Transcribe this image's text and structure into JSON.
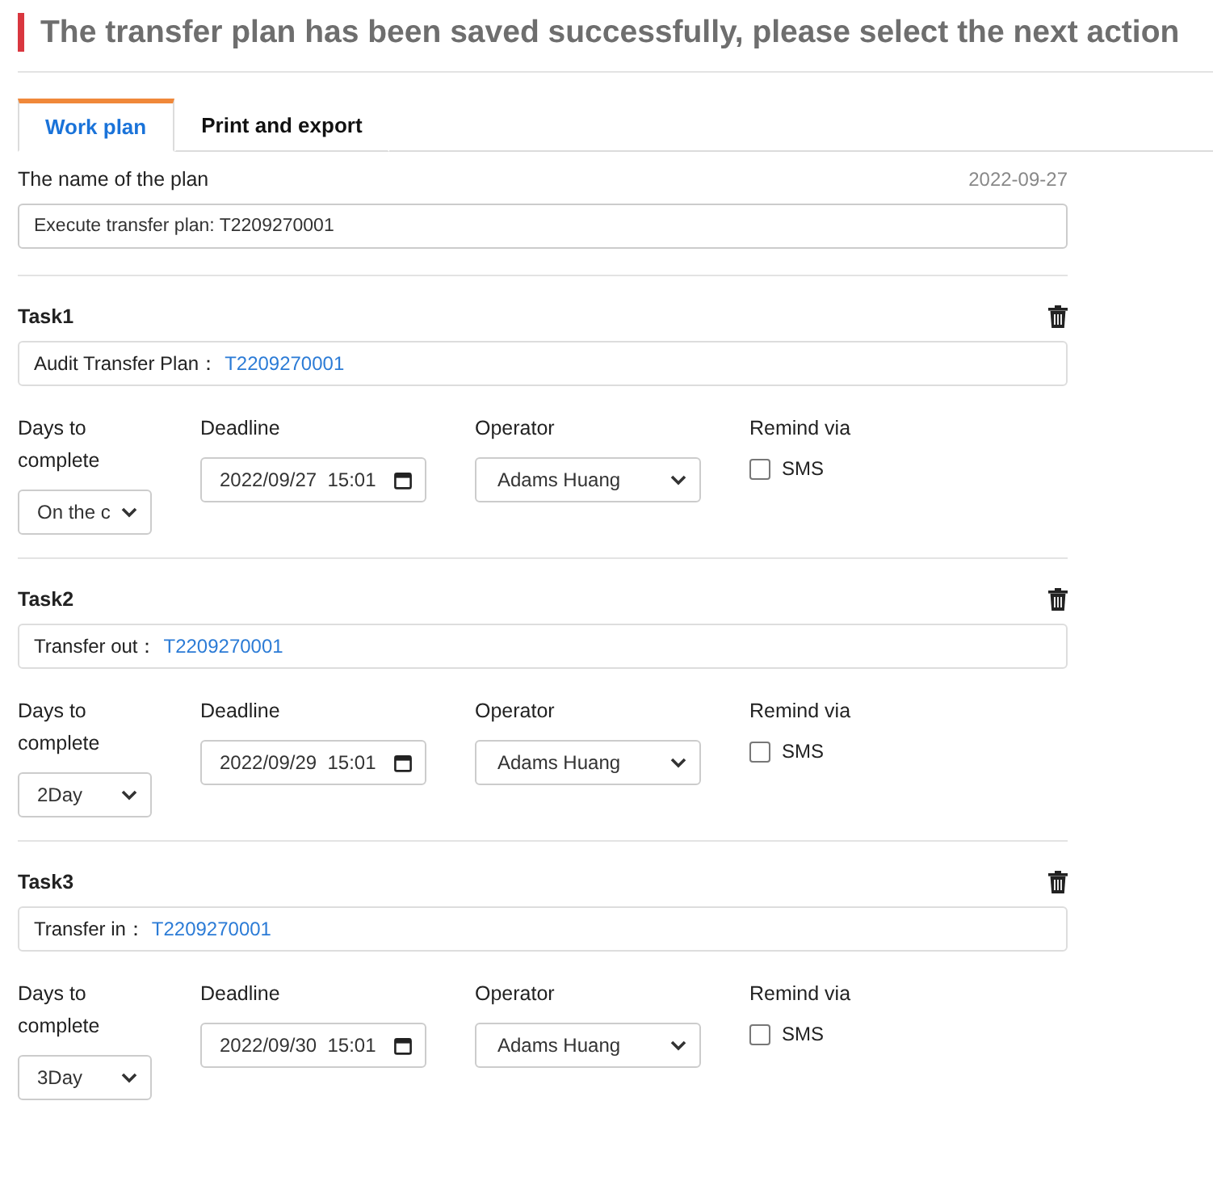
{
  "title": "The transfer plan has been saved successfully, please select the next action",
  "tabs": [
    {
      "label": "Work plan",
      "selected": true
    },
    {
      "label": "Print and export",
      "selected": false
    }
  ],
  "plan": {
    "label": "The name of the plan",
    "date": "2022-09-27",
    "value": "Execute transfer plan: T2209270001"
  },
  "tasks": [
    {
      "title": "Task1",
      "action": "Audit Transfer Plan：",
      "link": "T2209270001",
      "days_label": "Days to complete",
      "days": "On the c",
      "deadline_label": "Deadline",
      "deadline": "2022/09/27  15:01",
      "operator_label": "Operator",
      "operator": "Adams Huang",
      "remind_label": "Remind via",
      "sms": {
        "label": "SMS",
        "checked": false
      }
    },
    {
      "title": "Task2",
      "action": "Transfer out：",
      "link": "T2209270001",
      "days_label": "Days to complete",
      "days": "2Day",
      "deadline_label": "Deadline",
      "deadline": "2022/09/29  15:01",
      "operator_label": "Operator",
      "operator": "Adams Huang",
      "remind_label": "Remind via",
      "sms": {
        "label": "SMS",
        "checked": false
      }
    },
    {
      "title": "Task3",
      "action": "Transfer in：",
      "link": "T2209270001",
      "days_label": "Days to complete",
      "days": "3Day",
      "deadline_label": "Deadline",
      "deadline": "2022/09/30  15:01",
      "operator_label": "Operator",
      "operator": "Adams Huang",
      "remind_label": "Remind via",
      "sms": {
        "label": "SMS",
        "checked": false
      }
    }
  ]
}
